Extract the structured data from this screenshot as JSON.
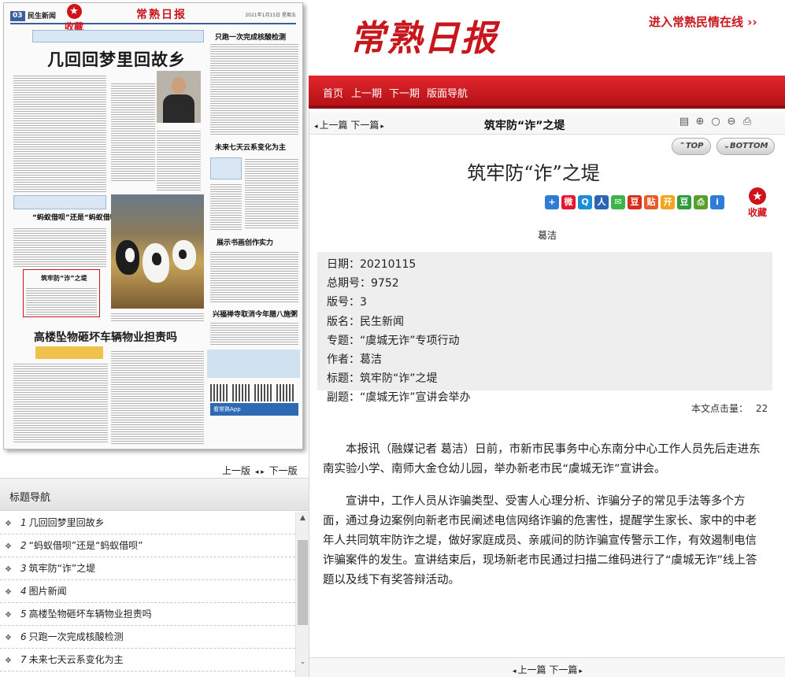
{
  "paper_preview": {
    "page_badge": "03",
    "section": "民生新闻",
    "logo": "常熟日报",
    "date_line": "2021年1月15日 星期五",
    "collect_label": "收藏",
    "headline_main": "几回回梦里回故乡",
    "headline_bottom": "高楼坠物砸坏车辆物业担责吗",
    "sub_a": "只跑一次完成核酸检测",
    "sub_b": "未来七天云系变化为主",
    "sub_c": "展示书画创作实力",
    "sub_d": "兴福禅寺取消今年腊八施粥",
    "sub_e": "“蚂蚁借呗”还是“蚂蚁借呗”",
    "sub_f": "筑牢防“诈”之堤",
    "app_bar": "看常熟App"
  },
  "page_nav": {
    "prev_page": "上一版",
    "next_page": "下一版"
  },
  "toc": {
    "title": "标题导航",
    "items": [
      {
        "num": "1",
        "title": "几回回梦里回故乡"
      },
      {
        "num": "2",
        "title": "“蚂蚁借呗”还是“蚂蚁借呗”"
      },
      {
        "num": "3",
        "title": "筑牢防“诈”之堤"
      },
      {
        "num": "4",
        "title": "图片新闻"
      },
      {
        "num": "5",
        "title": "高楼坠物砸坏车辆物业担责吗"
      },
      {
        "num": "6",
        "title": "只跑一次完成核酸检测"
      },
      {
        "num": "7",
        "title": "未来七天云系变化为主"
      }
    ]
  },
  "header": {
    "brand": "常熟日报",
    "online_link": "进入常熟民情在线 ››",
    "nav": [
      "首页",
      "上一期",
      "下一期",
      "版面导航"
    ]
  },
  "toolbar": {
    "prev_article": "上一篇",
    "next_article": "下一篇",
    "title": "筑牢防“诈”之堤",
    "top_label": "TOP",
    "bottom_label": "BOTTOM"
  },
  "article": {
    "title": "筑牢防“诈”之堤",
    "collect_label": "收藏",
    "author_top": "葛洁",
    "meta": [
      {
        "label": "日期：",
        "value": "20210115"
      },
      {
        "label": "总期号：",
        "value": "9752"
      },
      {
        "label": "版号：",
        "value": "3"
      },
      {
        "label": "版名：",
        "value": "民生新闻"
      },
      {
        "label": "专题：",
        "value": "“虞城无诈”专项行动"
      },
      {
        "label": "作者：",
        "value": "葛洁"
      },
      {
        "label": "标题：",
        "value": "筑牢防“诈”之堤"
      },
      {
        "label": "副题：",
        "value": "“虞城无诈”宣讲会举办"
      }
    ],
    "hits_label": "本文点击量：",
    "hits_value": "22",
    "paragraphs": [
      "本报讯（融媒记者 葛洁）日前，市新市民事务中心东南分中心工作人员先后走进东南实验小学、南师大金仓幼儿园，举办新老市民“虞城无诈”宣讲会。",
      "宣讲中，工作人员从诈骗类型、受害人心理分析、诈骗分子的常见手法等多个方面，通过身边案例向新老市民阐述电信网络诈骗的危害性，提醒学生家长、家中的中老年人共同筑牢防诈之堤，做好家庭成员、亲戚间的防诈骗宣传警示工作，有效遏制电信诈骗案件的发生。宣讲结束后，现场新老市民通过扫描二维码进行了“虞城无诈”线上答题以及线下有奖答辩活动。"
    ]
  },
  "bottom_nav": {
    "prev_article": "上一篇",
    "next_article": "下一篇"
  },
  "colors": {
    "brand_red": "#c8161d",
    "nav_red": "#d11c23",
    "meta_bg": "#eeeeee"
  },
  "icons": {
    "share": [
      "plus-icon",
      "weibo-icon",
      "qzone-icon",
      "renren-icon",
      "wechat-icon",
      "douban-icon",
      "tieba-icon",
      "kaixin-icon",
      "douban-green-icon",
      "print-icon",
      "info-icon"
    ],
    "tools": [
      "note-icon",
      "zoom-in-icon",
      "search-icon",
      "zoom-out-icon",
      "print-icon"
    ]
  }
}
